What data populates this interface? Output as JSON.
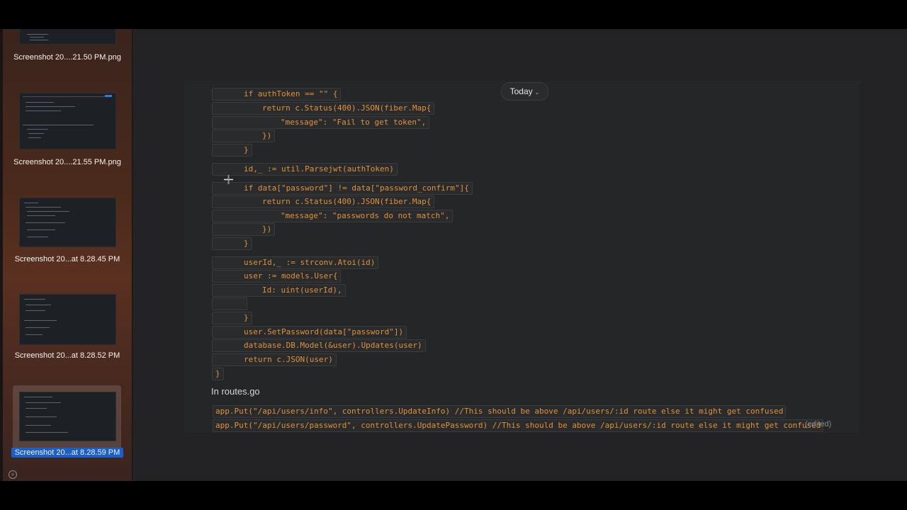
{
  "sidebar": {
    "items": [
      {
        "label": "Screenshot 20....21.50 PM.png",
        "selected": false
      },
      {
        "label": "Screenshot 20....21.55 PM.png",
        "selected": false
      },
      {
        "label": "Screenshot 20...at 8.28.45 PM",
        "selected": false
      },
      {
        "label": "Screenshot 20...at 8.28.52 PM",
        "selected": false
      },
      {
        "label": "Screenshot 20...at 8.28.59 PM",
        "selected": true
      }
    ],
    "add_icon": "plus-circle-icon"
  },
  "chat": {
    "date_pill": "Today",
    "code": [
      {
        "indent": 1,
        "text": "if authToken == \"\" {"
      },
      {
        "indent": 2,
        "text": "return c.Status(400).JSON(fiber.Map{"
      },
      {
        "indent": 3,
        "text": "\"message\": \"Fail to get token\","
      },
      {
        "indent": 2,
        "text": "})"
      },
      {
        "indent": 1,
        "text": "}"
      },
      {
        "indent": 1,
        "text": "id,_ := util.Parsejwt(authToken)"
      },
      {
        "indent": 1,
        "text": "if data[\"password\"] != data[\"password_confirm\"]{"
      },
      {
        "indent": 2,
        "text": "return c.Status(400).JSON(fiber.Map{"
      },
      {
        "indent": 3,
        "text": "\"message\": \"passwords do not match\","
      },
      {
        "indent": 2,
        "text": "})"
      },
      {
        "indent": 1,
        "text": "}"
      },
      {
        "indent": 1,
        "text": "userId,_ := strconv.Atoi(id)"
      },
      {
        "indent": 1,
        "text": "user := models.User{"
      },
      {
        "indent": 2,
        "text": "Id: uint(userId),"
      },
      {
        "indent": 1,
        "text": ""
      },
      {
        "indent": 1,
        "text": "}"
      },
      {
        "indent": 1,
        "text": "user.SetPassword(data[\"password\"])"
      },
      {
        "indent": 1,
        "text": "database.DB.Model(&user).Updates(user)"
      },
      {
        "indent": 1,
        "text": "return c.JSON(user)"
      },
      {
        "indent": 0,
        "text": "}"
      }
    ],
    "routes_heading": "In routes.go",
    "routes": [
      "app.Put(\"/api/users/info\", controllers.UpdateInfo) //This should be above /api/users/:id route else it might get confused",
      "app.Put(\"/api/users/password\", controllers.UpdatePassword) //This should be above /api/users/:id route else it might get confused"
    ],
    "edited_label": "(edited)"
  },
  "colors": {
    "code_text": "#e0913a",
    "selection": "#1b5fc9"
  }
}
